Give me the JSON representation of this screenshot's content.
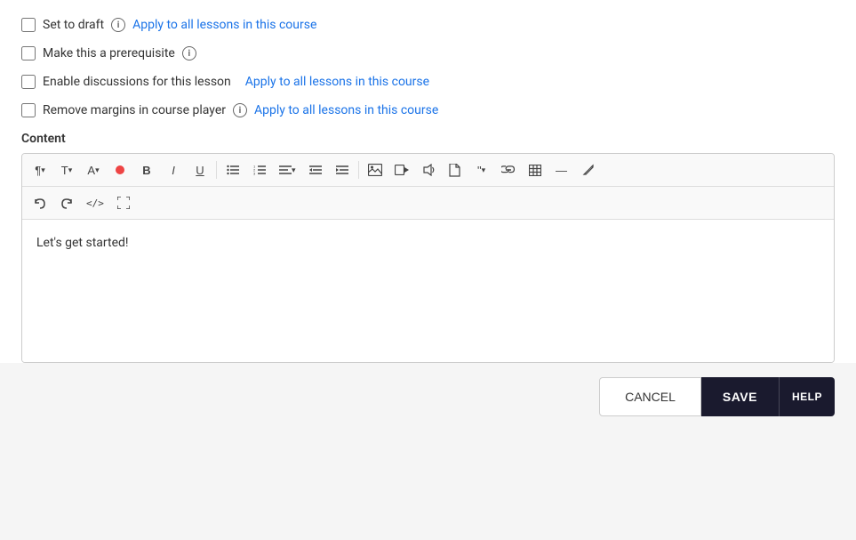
{
  "checkboxes": {
    "set_to_draft": {
      "label": "Set to draft",
      "apply_link": "Apply to all lessons in this course",
      "checked": false
    },
    "make_prerequisite": {
      "label": "Make this a prerequisite",
      "checked": false
    },
    "enable_discussions": {
      "label": "Enable discussions for this lesson",
      "apply_link": "Apply to all lessons in this course",
      "checked": false
    },
    "remove_margins": {
      "label": "Remove margins in course player",
      "apply_link": "Apply to all lessons in this course",
      "checked": false
    }
  },
  "content": {
    "label": "Content",
    "editor_text": "Let's get started!"
  },
  "toolbar": {
    "row1": [
      {
        "id": "paragraph",
        "label": "¶▾"
      },
      {
        "id": "text-size",
        "label": "T↕▾"
      },
      {
        "id": "font-color",
        "label": "A▾"
      },
      {
        "id": "highlight",
        "label": "◉"
      },
      {
        "id": "bold",
        "label": "B"
      },
      {
        "id": "italic",
        "label": "I"
      },
      {
        "id": "underline",
        "label": "U"
      },
      {
        "id": "bullet-list",
        "label": "≡"
      },
      {
        "id": "ordered-list",
        "label": "1≡"
      },
      {
        "id": "align",
        "label": "≡▾"
      },
      {
        "id": "outdent",
        "label": "⇤"
      },
      {
        "id": "indent",
        "label": "⇥"
      },
      {
        "id": "image",
        "label": "🖼"
      },
      {
        "id": "video",
        "label": "▶"
      },
      {
        "id": "audio",
        "label": "♪"
      },
      {
        "id": "file",
        "label": "📄"
      },
      {
        "id": "blockquote",
        "label": "❝▾"
      },
      {
        "id": "link",
        "label": "🔗"
      },
      {
        "id": "table",
        "label": "⊞"
      },
      {
        "id": "horizontal-rule",
        "label": "—"
      },
      {
        "id": "pen",
        "label": "✏"
      }
    ],
    "row2": [
      {
        "id": "undo",
        "label": "↺"
      },
      {
        "id": "redo",
        "label": "↻"
      },
      {
        "id": "code",
        "label": "</>"
      },
      {
        "id": "fullscreen",
        "label": "⛶"
      }
    ]
  },
  "buttons": {
    "cancel": "CANCEL",
    "save": "SAVE",
    "help": "HELP"
  }
}
